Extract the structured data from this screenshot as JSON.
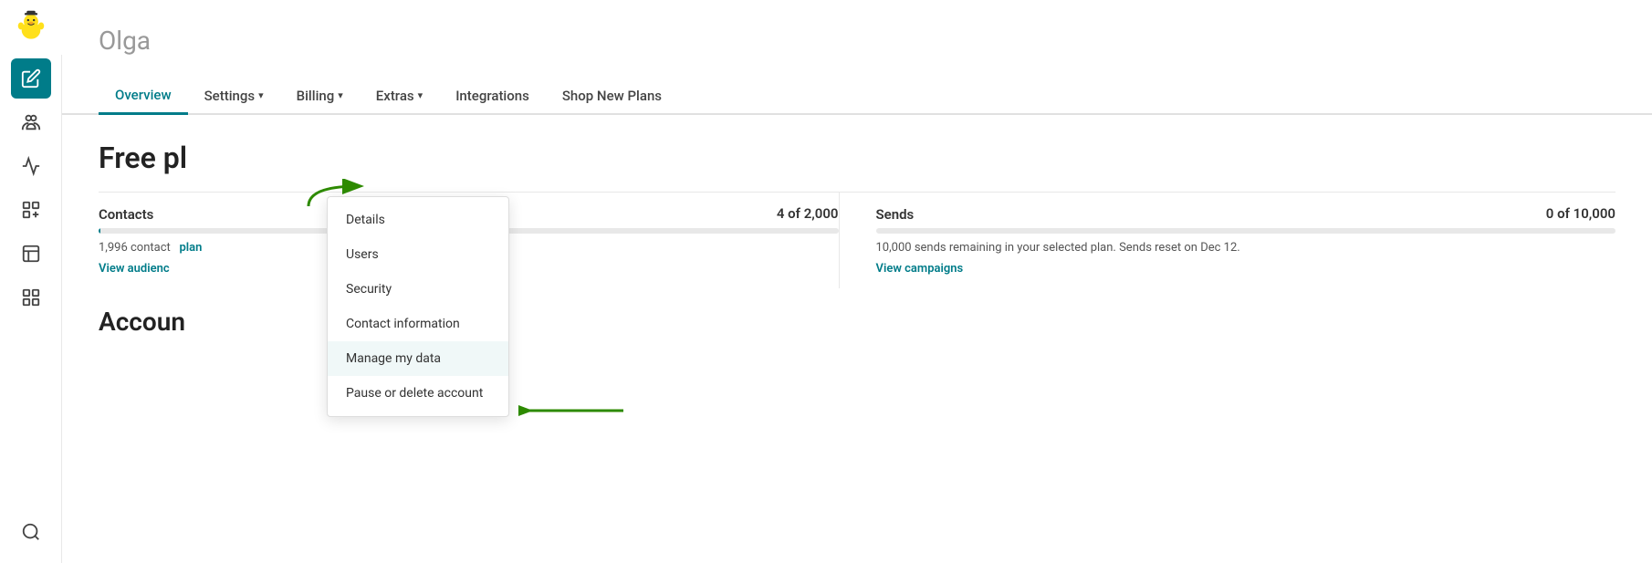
{
  "sidebar": {
    "logo_alt": "Mailchimp logo",
    "items": [
      {
        "id": "create",
        "label": "Create",
        "active": true,
        "icon": "pencil"
      },
      {
        "id": "audience",
        "label": "Audience",
        "active": false,
        "icon": "audience"
      },
      {
        "id": "campaigns",
        "label": "Campaigns",
        "active": false,
        "icon": "campaigns"
      },
      {
        "id": "automations",
        "label": "Automations",
        "active": false,
        "icon": "automations"
      },
      {
        "id": "content",
        "label": "Content",
        "active": false,
        "icon": "content"
      },
      {
        "id": "analytics",
        "label": "Analytics",
        "active": false,
        "icon": "analytics"
      },
      {
        "id": "search",
        "label": "Search",
        "active": false,
        "icon": "search"
      }
    ]
  },
  "page": {
    "user_name": "Olga",
    "tabs": [
      {
        "id": "overview",
        "label": "Overview",
        "active": true,
        "has_dropdown": false
      },
      {
        "id": "settings",
        "label": "Settings",
        "active": false,
        "has_dropdown": true
      },
      {
        "id": "billing",
        "label": "Billing",
        "active": false,
        "has_dropdown": true
      },
      {
        "id": "extras",
        "label": "Extras",
        "active": false,
        "has_dropdown": true
      },
      {
        "id": "integrations",
        "label": "Integrations",
        "active": false,
        "has_dropdown": false
      },
      {
        "id": "shop-new-plans",
        "label": "Shop New Plans",
        "active": false,
        "has_dropdown": false
      }
    ],
    "settings_dropdown": {
      "items": [
        {
          "id": "details",
          "label": "Details"
        },
        {
          "id": "users",
          "label": "Users"
        },
        {
          "id": "security",
          "label": "Security"
        },
        {
          "id": "contact-information",
          "label": "Contact information"
        },
        {
          "id": "manage-my-data",
          "label": "Manage my data",
          "highlighted": true
        },
        {
          "id": "pause-or-delete",
          "label": "Pause or delete account"
        }
      ]
    },
    "plan_title": "Free pl",
    "contacts": {
      "label": "Contacts",
      "count_text": "4 of 2,000",
      "progress_pct": 0.2,
      "detail_text": "1,996 contact",
      "link_text": "View audienc",
      "plan_text": "plan"
    },
    "sends": {
      "label": "Sends",
      "count_text": "0 of 10,000",
      "progress_pct": 0,
      "detail_text": "10,000 sends remaining in your selected plan. Sends reset on Dec 12.",
      "link_text": "View campaigns"
    },
    "account_section": "Accoun"
  }
}
